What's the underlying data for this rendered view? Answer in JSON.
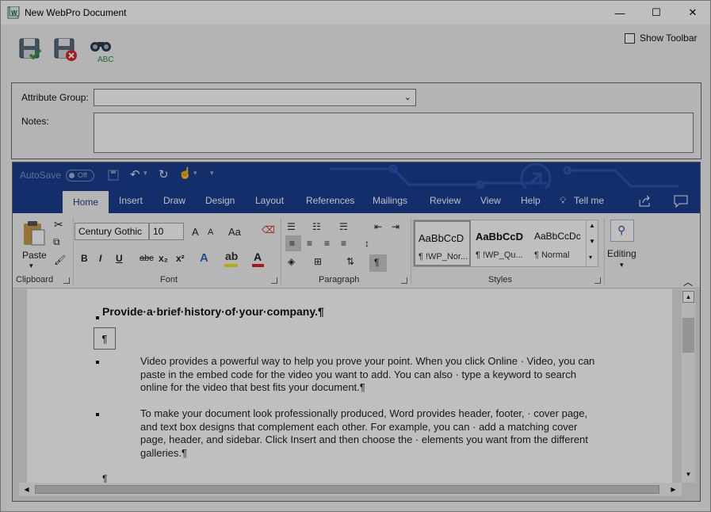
{
  "window": {
    "title": "New WebPro Document",
    "minimize": "—",
    "maximize": "☐",
    "close": "✕"
  },
  "toolbar": {
    "show_toolbar_label": "Show Toolbar",
    "save_icon": "save-check-icon",
    "save_close_icon": "save-cancel-icon",
    "spell_icon": "binoculars-abc-icon"
  },
  "attributes": {
    "group_label": "Attribute Group:",
    "group_value": "",
    "notes_label": "Notes:",
    "notes_value": ""
  },
  "word": {
    "qat": {
      "autosave": "AutoSave",
      "autosave_state": "Off"
    },
    "tabs": [
      "Home",
      "Insert",
      "Draw",
      "Design",
      "Layout",
      "References",
      "Mailings",
      "Review",
      "View",
      "Help"
    ],
    "tell_me": "Tell me",
    "ribbon": {
      "paste": "Paste",
      "clipboard": "Clipboard",
      "font_name": "Century Gothic",
      "font_size": "10",
      "grow": "A",
      "shrink": "A",
      "change_case": "Aa",
      "bold": "B",
      "italic": "I",
      "underline": "U",
      "strike": "abc",
      "sub": "x₂",
      "sup": "x²",
      "font": "Font",
      "paragraph": "Paragraph",
      "styles": [
        {
          "sample": "AaBbCcD",
          "name": "¶ !WP_Nor..."
        },
        {
          "sample": "AaBbCcD",
          "name": "¶ !WP_Qu..."
        },
        {
          "sample": "AaBbCcDc",
          "name": "¶ Normal"
        }
      ],
      "styles_label": "Styles",
      "editing": "Editing"
    },
    "document": {
      "heading": "Provide·a·brief·history·of·your·company.¶",
      "empty_mark": "¶",
      "para1": "Video provides a powerful way to help you prove your point. When you click Online · Video, you can paste in the embed code for the video you want to add. You can also · type a keyword to search online for the video that best fits your document.¶",
      "para2": "To make your document look professionally produced, Word provides header, footer, · cover page, and text box designs that complement each other. For example, you can · add a matching cover page, header, and sidebar. Click Insert and then choose the · elements you want from the different galleries.¶",
      "trailing_mark": "¶"
    }
  },
  "colors": {
    "word_blue": "#1b3d8f",
    "ribbon_bg": "#f3f3f3"
  }
}
